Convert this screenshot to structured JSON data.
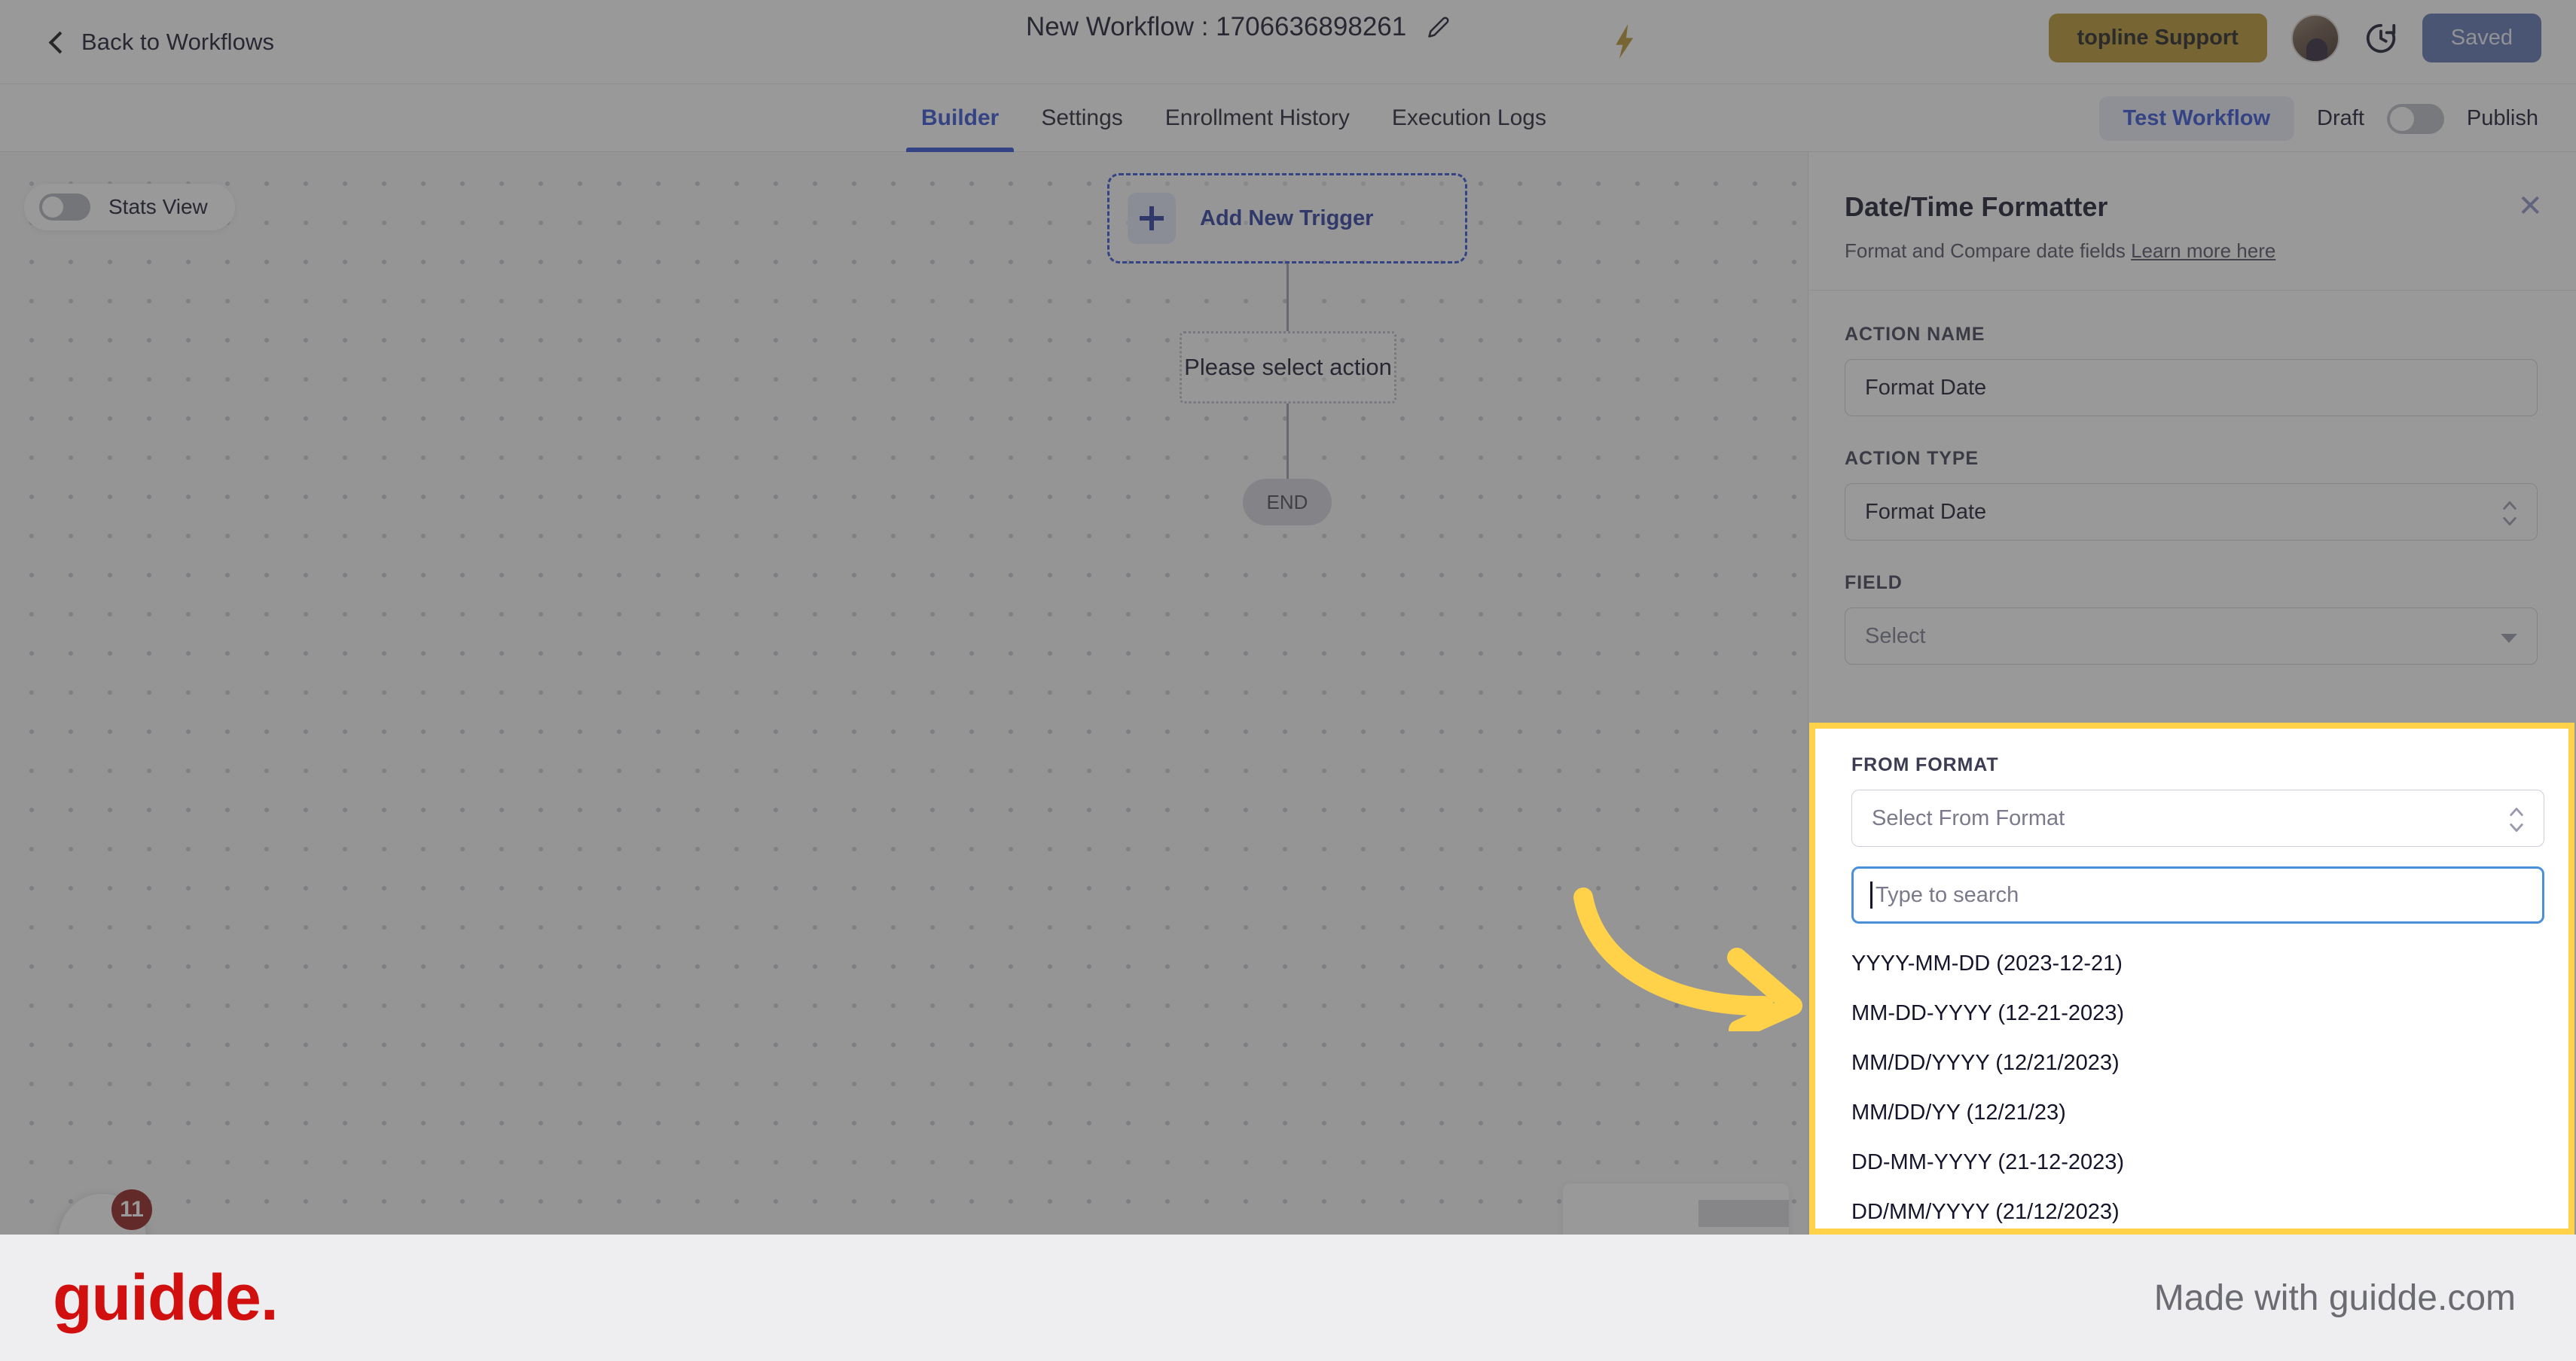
{
  "header": {
    "back_label": "Back to Workflows",
    "back_icon": "chevron-left-icon",
    "workflow_title": "New Workflow : 1706636898261",
    "edit_icon": "pencil-icon",
    "bolt_icon": "lightning-bolt-icon",
    "support_button": "topline Support",
    "support_brand": "topline",
    "support_suffix": " Support",
    "history_icon": "clock-history-icon",
    "saved_button": "Saved",
    "avatar": "user-avatar",
    "support_color": "#b8922c",
    "saved_color": "#5a6fb0"
  },
  "tabbar": {
    "tabs": [
      {
        "label": "Builder",
        "active": true
      },
      {
        "label": "Settings",
        "active": false
      },
      {
        "label": "Enrollment History",
        "active": false
      },
      {
        "label": "Execution Logs",
        "active": false
      }
    ],
    "test_workflow": "Test Workflow",
    "draft_label": "Draft",
    "publish_label": "Publish",
    "publish_toggle_on": false,
    "accent_color": "#2d4bd4"
  },
  "canvas": {
    "stats_view_label": "Stats View",
    "stats_view_on": false,
    "add_trigger_label": "Add New Trigger",
    "add_trigger_icon": "plus-icon",
    "action_placeholder": "Please select action",
    "end_label": "END",
    "chat_badge_count": "11",
    "annotation_arrow": "yellow-curved-arrow",
    "annotation_color": "#ffd24a"
  },
  "panel": {
    "title": "Date/Time Formatter",
    "subtitle": "Format and Compare date fields",
    "link_text": "Learn more here",
    "close_icon": "close-icon",
    "action_name_label": "ACTION NAME",
    "action_name_value": "Format Date",
    "action_type_label": "ACTION TYPE",
    "action_type_value": "Format Date",
    "field_label": "FIELD",
    "field_value": "Select"
  },
  "from_format": {
    "label": "FROM FORMAT",
    "select_placeholder": "Select From Format",
    "search_placeholder": "Type to search",
    "search_value": "",
    "options": [
      "YYYY-MM-DD (2023-12-21)",
      "MM-DD-YYYY (12-21-2023)",
      "MM/DD/YYYY (12/21/2023)",
      "MM/DD/YY (12/21/23)",
      "DD-MM-YYYY (21-12-2023)",
      "DD/MM/YYYY (21/12/2023)"
    ],
    "highlight_color": "#ffd24a",
    "focus_color": "#4a90d9"
  },
  "footer": {
    "logo_text": "guidde.",
    "made_with": "Made with guidde.com",
    "logo_color": "#d10f0f"
  }
}
